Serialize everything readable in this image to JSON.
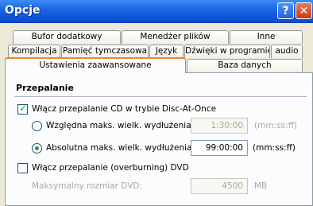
{
  "window": {
    "title": "Opcje"
  },
  "tabs_row1": [
    "Bufor dodatkowy",
    "Menedżer plików",
    "Inne"
  ],
  "tabs_row2": [
    "Kompilacja",
    "Pamięć tymczasowa",
    "Język",
    "Dźwięki w programie",
    "audio"
  ],
  "tabs_row3": [
    "Ustawienia zaawansowane",
    "Baza danych"
  ],
  "section": {
    "title": "Przepalanie"
  },
  "disc_at_once": {
    "label": "Włącz przepalanie CD w trybie Disc-At-Once",
    "checked": true
  },
  "relative": {
    "label": "Względna maks. wielk. wydłużenia:",
    "value": "1:30:00",
    "unit": "(mm:ss:ff)",
    "selected": false
  },
  "absolute": {
    "label": "Absolutna maks. wielk. wydłużenia:",
    "value": "99:00:00",
    "unit": "(mm:ss:ff)",
    "selected": true
  },
  "dvd_overburn": {
    "label": "Włącz przepalanie (overburning) DVD",
    "checked": false
  },
  "dvd_max": {
    "label": "Maksymalny rozmiar DVD:",
    "value": "4500",
    "unit": "MB"
  }
}
